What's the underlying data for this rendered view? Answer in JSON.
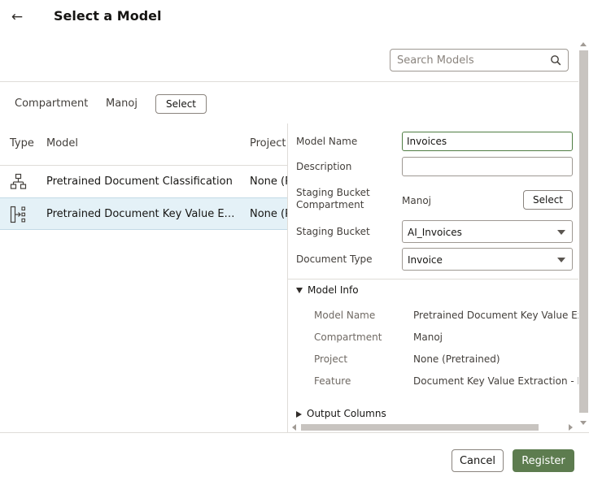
{
  "header": {
    "title": "Select a Model",
    "back_icon": "arrow-left-icon"
  },
  "search": {
    "placeholder": "Search Models",
    "value": "",
    "icon": "search-icon"
  },
  "compartment": {
    "label": "Compartment",
    "value": "Manoj",
    "select_label": "Select"
  },
  "table": {
    "columns": [
      "Type",
      "Model",
      "Project"
    ],
    "rows": [
      {
        "icon": "hierarchy-icon",
        "model": "Pretrained Document Classification",
        "project": "None (Pretrained)",
        "selected": false
      },
      {
        "icon": "key-value-extraction-icon",
        "model": "Pretrained Document Key Value Extraction",
        "project": "None (Pretrained)",
        "selected": true
      }
    ]
  },
  "form": {
    "model_name_label": "Model Name",
    "model_name_value": "Invoices",
    "description_label": "Description",
    "description_value": "",
    "staging_compartment_label": "Staging Bucket Compartment",
    "staging_compartment_value": "Manoj",
    "staging_select_label": "Select",
    "staging_bucket_label": "Staging Bucket",
    "staging_bucket_value": "AI_Invoices",
    "document_type_label": "Document Type",
    "document_type_value": "Invoice"
  },
  "model_info": {
    "title": "Model Info",
    "expanded": true,
    "fields": [
      {
        "label": "Model Name",
        "value": "Pretrained Document Key Value Extraction"
      },
      {
        "label": "Compartment",
        "value": "Manoj"
      },
      {
        "label": "Project",
        "value": "None (Pretrained)"
      },
      {
        "label": "Feature",
        "value": "Document Key Value Extraction - Invoice"
      }
    ]
  },
  "output_columns": {
    "title": "Output Columns",
    "expanded": false
  },
  "footer": {
    "cancel_label": "Cancel",
    "register_label": "Register"
  },
  "colors": {
    "primary": "#5d7c4f",
    "selected_row": "#e4f1f7",
    "border": "#dfdcd8",
    "focus": "#4f7d42"
  }
}
